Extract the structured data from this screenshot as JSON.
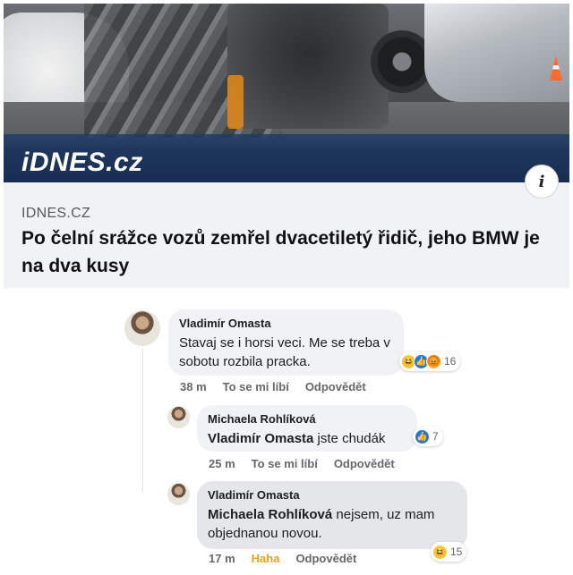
{
  "post": {
    "brand": "iDNES.cz",
    "info_icon": "i",
    "source": "IDNES.CZ",
    "headline": "Po čelní srážce vozů zemřel dvacetiletý řidič, jeho BMW je na dva kusy"
  },
  "comments": [
    {
      "author": "Vladimír Omasta",
      "text": "Stavaj se i horsi veci. Me se treba v sobotu rozbila pracka.",
      "time": "38 m",
      "like_label": "To se mi líbí",
      "reply_label": "Odpovědět",
      "reaction_count": "16",
      "reactions": [
        "haha-icon",
        "like-icon",
        "angry-icon"
      ]
    },
    {
      "author": "Michaela Rohlíková",
      "mention": "Vladimír Omasta",
      "text": " jste chudák",
      "time": "25 m",
      "like_label": "To se mi líbí",
      "reply_label": "Odpovědět",
      "reaction_count": "7",
      "reactions": [
        "like-icon"
      ]
    },
    {
      "author": "Vladimír Omasta",
      "mention": "Michaela Rohlíková",
      "text": " nejsem, uz mam objednanou novou.",
      "time": "17 m",
      "like_label": "Haha",
      "reply_label": "Odpovědět",
      "reaction_count": "15",
      "reactions": [
        "haha-icon"
      ]
    }
  ],
  "colors": {
    "brand_bar": "#1c3a68",
    "bubble": "#f0f2f5",
    "bubble_dark": "#e4e6e9",
    "haha": "#e8a317",
    "like": "#1877f2"
  }
}
